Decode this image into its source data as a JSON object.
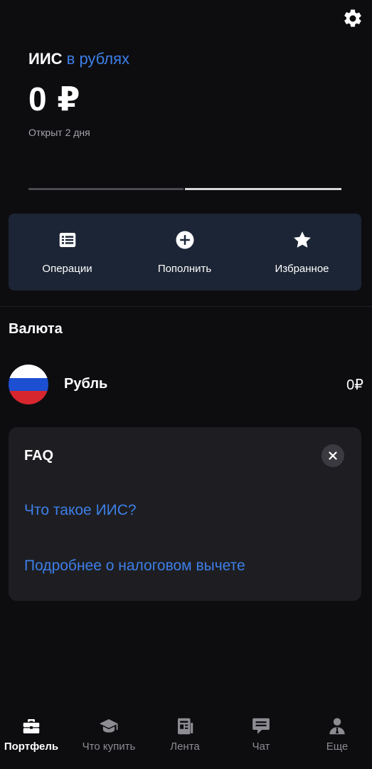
{
  "header": {
    "settings_icon": "gear-icon",
    "account_name": "ИИС",
    "account_currency": "в рублях",
    "amount": "0 ₽",
    "opened": "Открыт 2 дня"
  },
  "actions": [
    {
      "label": "Операции",
      "icon": "list-icon"
    },
    {
      "label": "Пополнить",
      "icon": "plus-circle-icon"
    },
    {
      "label": "Избранное",
      "icon": "star-icon"
    }
  ],
  "currency_section": {
    "title": "Валюта",
    "item": {
      "name": "Рубль",
      "value": "0₽",
      "icon": "russia-flag-icon"
    }
  },
  "faq": {
    "title": "FAQ",
    "links": [
      "Что такое ИИС?",
      "Подробнее о налоговом вычете"
    ]
  },
  "tabbar": [
    {
      "label": "Портфель",
      "icon": "briefcase-icon",
      "active": true
    },
    {
      "label": "Что купить",
      "icon": "graduation-cap-icon",
      "active": false
    },
    {
      "label": "Лента",
      "icon": "news-icon",
      "active": false
    },
    {
      "label": "Чат",
      "icon": "chat-icon",
      "active": false
    },
    {
      "label": "Еще",
      "icon": "profile-icon",
      "active": false
    }
  ],
  "colors": {
    "background": "#0d0d10",
    "accent": "#3d7fe8",
    "actions_card": "#1c2535",
    "faq_card": "#1e1e22"
  }
}
